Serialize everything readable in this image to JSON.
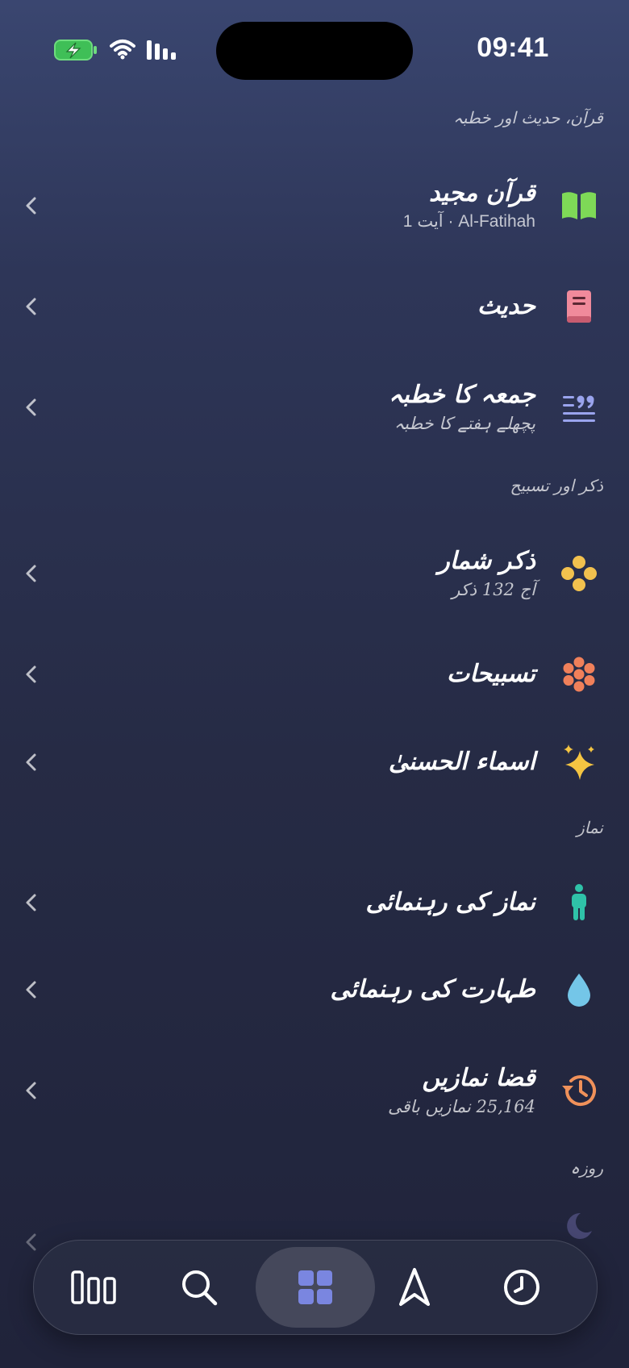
{
  "status_bar": {
    "time": "09:41"
  },
  "sections": {
    "quran": "قرآن، حدیث اور خطبہ",
    "zikr": "ذکر اور تسبیح",
    "namaz": "نماز",
    "roza": "روزہ"
  },
  "rows": {
    "quran": {
      "title": "قرآن مجید",
      "subtitle": "Al-Fatihah · آیت 1"
    },
    "hadith": {
      "title": "حدیث"
    },
    "khutbah": {
      "title": "جمعہ کا خطبہ",
      "subtitle": "پچھلے ہفتے کا خطبہ"
    },
    "zikr_counter": {
      "title": "ذکر شمار",
      "subtitle": "آج 132 ذکر"
    },
    "tasbihat": {
      "title": "تسبیحات"
    },
    "asma": {
      "title": "اسماء الحسنیٰ"
    },
    "namaz_guide": {
      "title": "نماز کی رہنمائی"
    },
    "taharat_guide": {
      "title": "طہارت کی رہنمائی"
    },
    "qaza": {
      "title": "قضا نمازیں",
      "subtitle": "25,164 نمازیں باقی"
    }
  },
  "icons": {
    "quran": "open-book-icon",
    "hadith": "book-icon",
    "khutbah": "quote-lines-icon",
    "zikr_counter": "beads-icon",
    "tasbihat": "flower-beads-icon",
    "asma": "sparkles-icon",
    "namaz_guide": "person-icon",
    "taharat_guide": "drop-icon",
    "qaza": "history-icon",
    "roza": "moon-icon"
  },
  "colors": {
    "quran": "#7ed957",
    "hadith": "#f08a9b",
    "khutbah": "#9aa4ee",
    "zikr_counter": "#f2c14e",
    "tasbihat": "#f0805a",
    "asma": "#f5c542",
    "namaz_guide": "#2fc2a8",
    "taharat_guide": "#74c6e8",
    "qaza": "#f0915a",
    "roza": "#8e86d6",
    "tab_active": "#7a86e0"
  },
  "tab_bar": {
    "tabs": [
      "library-tab",
      "search-tab",
      "home-tab",
      "qibla-tab",
      "prayer-times-tab"
    ],
    "active": "home-tab"
  }
}
